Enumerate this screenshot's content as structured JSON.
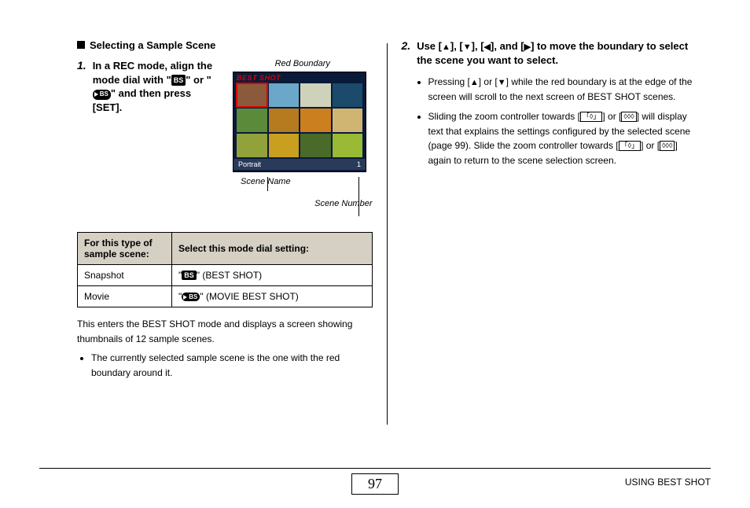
{
  "left": {
    "heading": "Selecting a Sample Scene",
    "step1_num": "1.",
    "step1_text_a": "In a REC mode, align the mode dial with \"",
    "step1_text_b": "\" or \"",
    "step1_text_c": "\" and then press [SET].",
    "callout_top": "Red Boundary",
    "screen_title": "BEST SHOT",
    "scene_bar_label": "Portrait",
    "scene_bar_num": "1",
    "callout_scene_name": "Scene Name",
    "callout_scene_number": "Scene Number",
    "table": {
      "h1": "For this type of sample scene:",
      "h2": "Select this mode dial setting:",
      "r1c1": "Snapshot",
      "r1c2a": "\"",
      "r1c2b": "\" (BEST SHOT)",
      "r2c1": "Movie",
      "r2c2a": "\"",
      "r2c2b": "\" (MOVIE BEST SHOT)"
    },
    "para": "This enters the BEST SHOT mode and displays a screen showing thumbnails of 12 sample scenes.",
    "bullet": "The currently selected sample scene is the one with the red boundary around it."
  },
  "right": {
    "step2_num": "2.",
    "step2_a": "Use [",
    "step2_b": "], [",
    "step2_c": "], [",
    "step2_d": "], and [",
    "step2_e": "] to move the boundary to select the scene you want to select.",
    "b1a": "Pressing [",
    "b1b": "] or [",
    "b1c": "] while the red boundary is at the edge of the screen will scroll to the next screen of BEST SHOT scenes.",
    "b2a": "Sliding the zoom controller towards [",
    "b2b": "] or [",
    "b2c": "] will display text that explains the settings configured by the selected scene (page 99). Slide the zoom controller towards [",
    "b2d": "] or [",
    "b2e": "] again to return to the scene selection screen.",
    "zoom_tele": "[►]",
    "zoom_wide": "[◄◄◄]"
  },
  "footer": {
    "page": "97",
    "title": "USING BEST SHOT"
  }
}
